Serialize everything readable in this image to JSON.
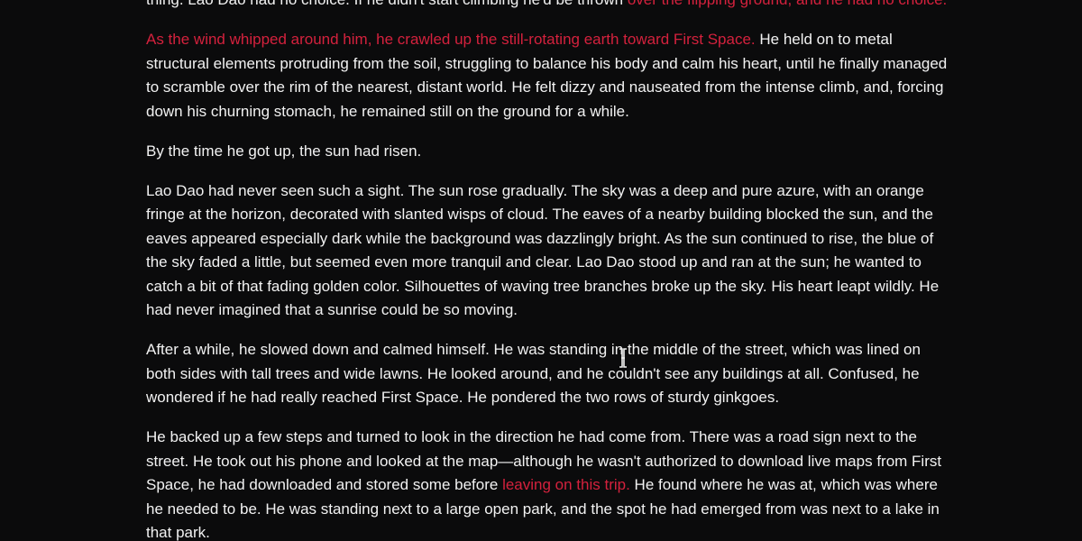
{
  "document": {
    "paragraphs": [
      {
        "segments": [
          {
            "text": "thing. Lao Dao had no choice. If he didn't start climbing he'd be thrown ",
            "hl": false
          },
          {
            "text": "over the flipping ground, and he had no choice.",
            "hl": true
          }
        ]
      },
      {
        "segments": [
          {
            "text": "As the wind whipped around him, he crawled up the still-rotating earth toward First Space. ",
            "hl": true
          },
          {
            "text": "He held on to metal structural elements protruding from the soil, struggling to balance his body and calm his heart, until he finally managed to scramble over the rim of the nearest, distant world. He felt dizzy and nauseated from the intense climb, and, forcing down his churning stomach, he remained still on the ground for a while.",
            "hl": false
          }
        ]
      },
      {
        "segments": [
          {
            "text": "By the time he got up, the sun had risen.",
            "hl": false
          }
        ]
      },
      {
        "segments": [
          {
            "text": "Lao Dao had never seen such a sight. The sun rose gradually. The sky was a deep and pure azure, with an orange fringe at the horizon, decorated with slanted wisps of cloud. The eaves of a nearby building blocked the sun, and the eaves appeared especially dark while the background was dazzlingly bright. As the sun continued to rise, the blue of the sky faded a little, but seemed even more tranquil and clear. Lao Dao stood up and ran at the sun; he wanted to catch a bit of that fading golden color. Silhouettes of waving tree branches broke up the sky. His heart leapt wildly. He had never imagined that a sunrise could be so moving.",
            "hl": false
          }
        ]
      },
      {
        "segments": [
          {
            "text": "After a while, he slowed down and calmed himself. He was standing in the middle of the street, which was lined on both sides with tall trees and wide lawns. He looked around, and he couldn't see any buildings at all. Confused, he wondered if he had really reached First Space. He pondered the two rows of sturdy ginkgoes.",
            "hl": false
          }
        ]
      },
      {
        "segments": [
          {
            "text": "He backed up a few steps and turned to look in the direction he had come from. There was a road sign next to the street. He took out his phone and looked at the map—although he wasn't authorized to download live maps from First Space, he had downloaded and stored some before ",
            "hl": false
          },
          {
            "text": "leaving on this trip.",
            "hl": true
          },
          {
            "text": " He found where he was at, which was where he needed to be. He was standing next to a large open park, and the spot he had emerged from was next to a lake in that park.",
            "hl": false
          }
        ]
      }
    ]
  },
  "cursor": {
    "icon": "text-cursor-icon"
  },
  "colors": {
    "background": "#0b0b0c",
    "text": "#f2f2f2",
    "highlight": "#d4213d"
  }
}
